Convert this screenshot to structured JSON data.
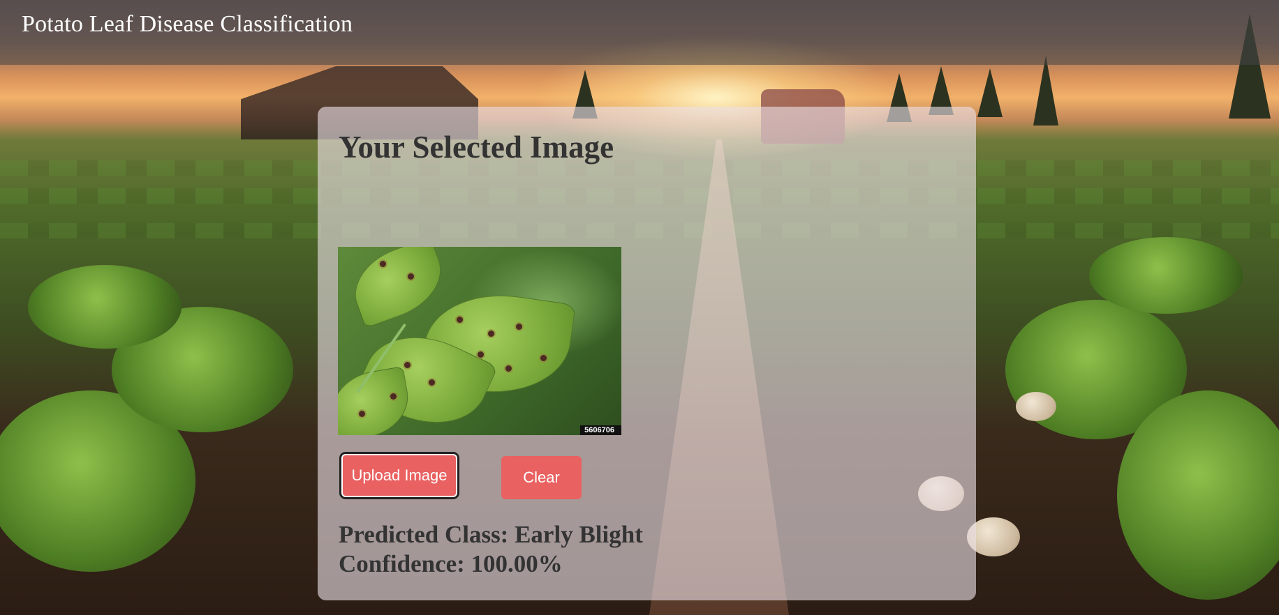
{
  "header": {
    "title": "Potato Leaf Disease Classification"
  },
  "card": {
    "title": "Your Selected Image",
    "image_id": "5606706",
    "upload_button_label": "Upload Image",
    "clear_button_label": "Clear",
    "prediction_text": "Predicted Class: Early Blight",
    "confidence_text": "Confidence: 100.00%"
  },
  "colors": {
    "button": "#e96161",
    "header_overlay": "rgba(70,70,70,0.55)",
    "card_overlay": "rgba(235,225,230,0.62)",
    "text_dark": "#333333"
  }
}
